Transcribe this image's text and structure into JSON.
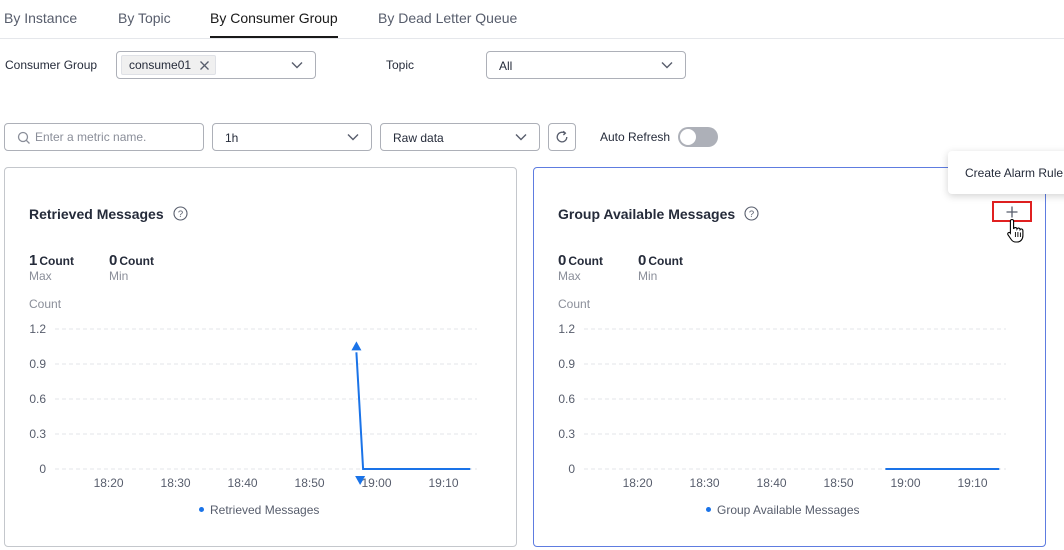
{
  "tabs": [
    {
      "label": "By Instance",
      "active": false
    },
    {
      "label": "By Topic",
      "active": false
    },
    {
      "label": "By Consumer Group",
      "active": true
    },
    {
      "label": "By Dead Letter Queue",
      "active": false
    }
  ],
  "filters": {
    "consumer_group_label": "Consumer Group",
    "consumer_group_tag": "consume01",
    "topic_label": "Topic",
    "topic_value": "All"
  },
  "toolbar": {
    "search_placeholder": "Enter a metric name.",
    "period_value": "1h",
    "data_type_value": "Raw data",
    "auto_refresh_label": "Auto Refresh",
    "auto_refresh_on": false
  },
  "colors": {
    "series": "#1a73e8",
    "grid": "#e3e5e8",
    "highlight": "#e02020"
  },
  "tooltip": {
    "label": "Create Alarm Rule"
  },
  "cards": [
    {
      "title": "Retrieved Messages",
      "max_value": "1",
      "max_unit": "Count",
      "max_label": "Max",
      "min_value": "0",
      "min_unit": "Count",
      "min_label": "Min",
      "unit_label": "Count",
      "legend": "Retrieved Messages"
    },
    {
      "title": "Group Available Messages",
      "max_value": "0",
      "max_unit": "Count",
      "max_label": "Max",
      "min_value": "0",
      "min_unit": "Count",
      "min_label": "Min",
      "unit_label": "Count",
      "legend": "Group Available Messages"
    }
  ],
  "chart_data": [
    {
      "type": "line",
      "unit": "Count",
      "x_ticks": [
        "18:20",
        "18:30",
        "18:40",
        "18:50",
        "19:00",
        "19:10"
      ],
      "y_ticks": [
        "0",
        "0.3",
        "0.6",
        "0.9",
        "1.2"
      ],
      "ylim": [
        0,
        1.2
      ],
      "x_range": [
        "18:12",
        "19:15"
      ],
      "grid": true,
      "legend_position": "bottom",
      "series": [
        {
          "name": "Retrieved Messages",
          "points": [
            [
              "18:57",
              1
            ],
            [
              "18:58",
              0
            ],
            [
              "19:14",
              0
            ]
          ],
          "max_marker": [
            "18:57",
            1
          ],
          "min_marker": [
            "18:58",
            0
          ]
        }
      ]
    },
    {
      "type": "line",
      "unit": "Count",
      "x_ticks": [
        "18:20",
        "18:30",
        "18:40",
        "18:50",
        "19:00",
        "19:10"
      ],
      "y_ticks": [
        "0",
        "0.3",
        "0.6",
        "0.9",
        "1.2"
      ],
      "ylim": [
        0,
        1.2
      ],
      "x_range": [
        "18:12",
        "19:15"
      ],
      "grid": true,
      "legend_position": "bottom",
      "series": [
        {
          "name": "Group Available Messages",
          "points": [
            [
              "18:57",
              0
            ],
            [
              "19:14",
              0
            ]
          ]
        }
      ]
    }
  ]
}
